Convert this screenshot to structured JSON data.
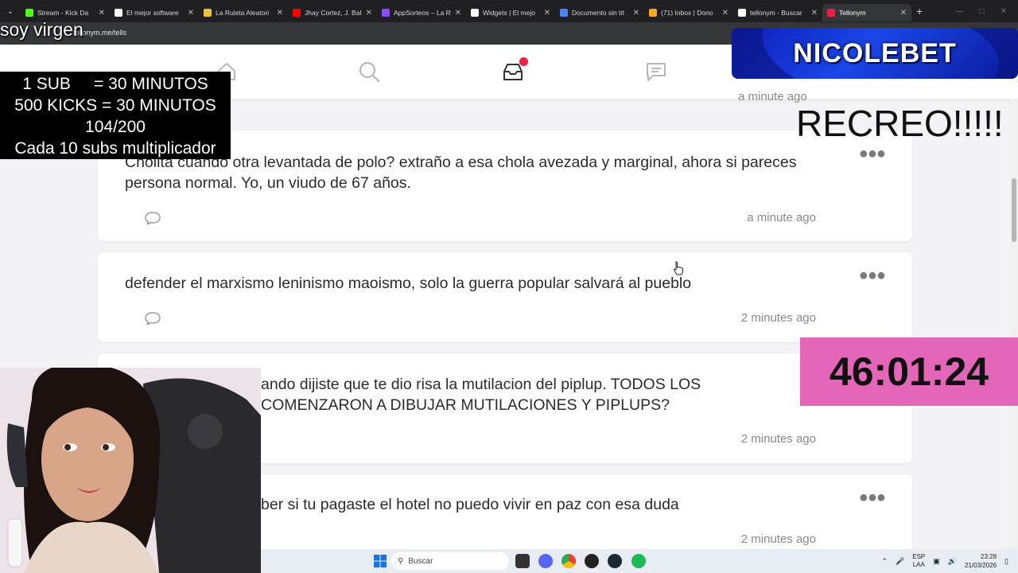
{
  "browser": {
    "tabs": [
      {
        "label": "Stream - Kick Da",
        "color": "#53fc18"
      },
      {
        "label": "El mejor software",
        "color": "#ffffff"
      },
      {
        "label": "La Ruleta Aleatori",
        "color": "#f0c040"
      },
      {
        "label": "Jhay Cortez, J. Bal",
        "color": "#ff0000"
      },
      {
        "label": "AppSorteos – La R",
        "color": "#8a4cff"
      },
      {
        "label": "Widgets | El mejo",
        "color": "#ffffff"
      },
      {
        "label": "Documento sin tít",
        "color": "#4a86f5"
      },
      {
        "label": "(71) Inbox | Dono",
        "color": "#f5a623"
      },
      {
        "label": "tellonym - Buscar",
        "color": "#ffffff"
      },
      {
        "label": "Tellonym",
        "color": "#ec2048"
      }
    ],
    "new_tab_symbol": "+",
    "url": "tellonym.me/tells"
  },
  "nav": {
    "icons": [
      "home-icon",
      "search-icon",
      "inbox-icon",
      "chat-icon"
    ],
    "accent": "#ec2048"
  },
  "feed": {
    "partial_time": "a minute ago",
    "tells": [
      {
        "text": "Cholita cuando otra levantada de polo? extraño a esa chola avezada y marginal, ahora si pareces persona normal. Yo, un viudo de 67 años.",
        "time": "a minute ago"
      },
      {
        "text": "defender el marxismo leninismo maoismo, solo la guerra popular salvará al pueblo",
        "time": "2 minutes ago"
      },
      {
        "text": "ando dijiste que te dio risa la mutilacion del piplup. TODOS LOS COMENZARON A DIBUJAR MUTILACIONES Y PIPLUPS?",
        "time": "2 minutes ago"
      },
      {
        "text": "ber si tu pagaste el hotel no puedo vivir en paz con esa duda",
        "time": "2 minutes ago"
      }
    ]
  },
  "overlays": {
    "soy": "soy virgen",
    "rules": [
      "1 SUB     = 30 MINUTOS",
      "500 KICKS = 30 MINUTOS",
      "104/200",
      "Cada 10 subs multiplicador"
    ],
    "brand": "NICOLEBET",
    "recreo": "RECREO!!!!!",
    "timer": "46:01:24"
  },
  "taskbar": {
    "search_placeholder": "Buscar",
    "lang_line1": "ESP",
    "lang_line2": "LAA",
    "time": "23:28",
    "date": "21/03/2026"
  }
}
